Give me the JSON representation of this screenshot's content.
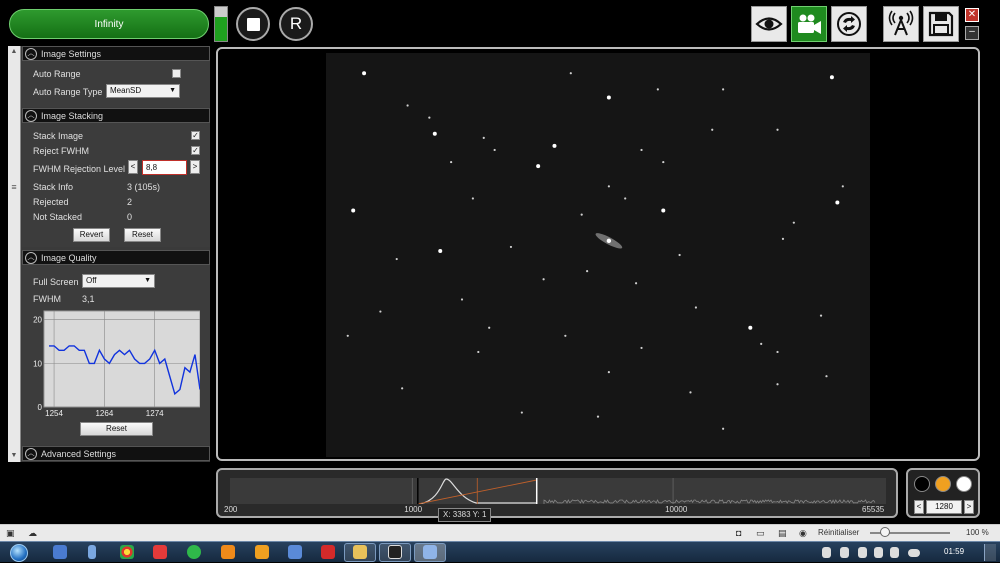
{
  "app": {
    "infinity_label": "Infinity",
    "level_percent": 70,
    "r_label": "R",
    "close_glyph": "✕",
    "minimize_glyph": "–",
    "toolbar_icons": [
      "eye-icon",
      "video-camera-icon",
      "loop-icon",
      "antenna-icon",
      "save-icon"
    ]
  },
  "image_settings": {
    "header": "Image Settings",
    "auto_range_label": "Auto Range",
    "auto_range_checked": false,
    "auto_range_type_label": "Auto Range Type",
    "auto_range_type_value": "MeanSD"
  },
  "image_stacking": {
    "header": "Image Stacking",
    "stack_image_label": "Stack Image",
    "stack_image_checked": true,
    "reject_fwhm_label": "Reject FWHM",
    "reject_fwhm_checked": true,
    "fwhm_rejection_label": "FWHM Rejection Level",
    "fwhm_rejection_value": "8,8",
    "stack_info_label": "Stack Info",
    "stack_info_value": "3 (105s)",
    "rejected_label": "Rejected",
    "rejected_value": "2",
    "not_stacked_label": "Not Stacked",
    "not_stacked_value": "0",
    "revert_label": "Revert",
    "reset_label": "Reset"
  },
  "image_quality": {
    "header": "Image Quality",
    "full_screen_label": "Full Screen",
    "full_screen_value": "Off",
    "fwhm_label": "FWHM",
    "fwhm_value": "3,1",
    "reset_label": "Reset"
  },
  "advanced_settings": {
    "header": "Advanced Settings"
  },
  "chart_data": {
    "type": "line",
    "title": "",
    "xlabel": "",
    "ylabel": "",
    "xlim": [
      1252,
      1283
    ],
    "ylim": [
      0,
      22
    ],
    "x_ticks": [
      "1254",
      "1264",
      "1274"
    ],
    "y_ticks": [
      "0",
      "10",
      "20"
    ],
    "grid": true,
    "x": [
      1253,
      1254,
      1255,
      1256,
      1257,
      1258,
      1259,
      1260,
      1261,
      1262,
      1263,
      1264,
      1265,
      1266,
      1267,
      1268,
      1269,
      1270,
      1271,
      1272,
      1273,
      1274,
      1275,
      1276,
      1277,
      1278,
      1279,
      1280,
      1281,
      1282,
      1283
    ],
    "y": [
      14,
      14,
      13,
      13,
      14,
      14,
      13,
      13,
      10,
      10,
      13,
      11,
      10,
      12,
      13,
      12,
      13,
      11,
      10,
      10,
      11,
      13,
      10,
      11,
      7,
      3,
      4,
      9,
      8,
      12,
      4
    ]
  },
  "histogram": {
    "ticks": [
      "200",
      "1000",
      "10000",
      "65535"
    ],
    "tick_values": [
      200,
      1000,
      10000,
      65535
    ],
    "black_point": 1050,
    "white_point": 3000
  },
  "color_panel": {
    "colors": [
      "#000000",
      "#f0a020",
      "#ffffff"
    ],
    "value": "1280",
    "dec_label": "<",
    "inc_label": ">"
  },
  "coords_label": "X: 3383 Y: 1",
  "status_bar": {
    "reset_label": "Réinitialiser",
    "zoom_label": "100 %"
  },
  "taskbar": {
    "clock": "01:59"
  },
  "stars": [
    [
      0.07,
      0.05,
      1
    ],
    [
      0.93,
      0.06,
      1
    ],
    [
      0.45,
      0.05,
      0
    ],
    [
      0.61,
      0.09,
      0
    ],
    [
      0.2,
      0.2,
      1
    ],
    [
      0.73,
      0.09,
      0
    ],
    [
      0.52,
      0.11,
      1
    ],
    [
      0.15,
      0.13,
      0
    ],
    [
      0.42,
      0.23,
      1
    ],
    [
      0.39,
      0.28,
      1
    ],
    [
      0.29,
      0.21,
      0
    ],
    [
      0.58,
      0.24,
      0
    ],
    [
      0.83,
      0.19,
      0
    ],
    [
      0.62,
      0.27,
      0
    ],
    [
      0.71,
      0.19,
      0
    ],
    [
      0.05,
      0.39,
      1
    ],
    [
      0.23,
      0.27,
      0
    ],
    [
      0.31,
      0.24,
      0
    ],
    [
      0.62,
      0.39,
      1
    ],
    [
      0.86,
      0.42,
      0
    ],
    [
      0.94,
      0.37,
      1
    ],
    [
      0.84,
      0.46,
      0
    ],
    [
      0.21,
      0.49,
      1
    ],
    [
      0.13,
      0.51,
      0
    ],
    [
      0.34,
      0.48,
      0
    ],
    [
      0.48,
      0.54,
      0
    ],
    [
      0.57,
      0.57,
      0
    ],
    [
      0.25,
      0.61,
      0
    ],
    [
      0.68,
      0.63,
      0
    ],
    [
      0.1,
      0.64,
      0
    ],
    [
      0.91,
      0.65,
      0
    ],
    [
      0.78,
      0.68,
      1
    ],
    [
      0.04,
      0.7,
      0
    ],
    [
      0.44,
      0.7,
      0
    ],
    [
      0.58,
      0.73,
      0
    ],
    [
      0.8,
      0.72,
      0
    ],
    [
      0.83,
      0.74,
      0
    ],
    [
      0.28,
      0.74,
      0
    ],
    [
      0.14,
      0.83,
      0
    ],
    [
      0.52,
      0.79,
      0
    ],
    [
      0.67,
      0.84,
      0
    ],
    [
      0.36,
      0.89,
      0
    ],
    [
      0.5,
      0.9,
      0
    ],
    [
      0.73,
      0.93,
      0
    ],
    [
      0.92,
      0.8,
      0
    ],
    [
      0.65,
      0.5,
      0
    ],
    [
      0.47,
      0.4,
      0
    ],
    [
      0.27,
      0.36,
      0
    ],
    [
      0.95,
      0.33,
      0
    ],
    [
      0.52,
      0.33,
      0
    ],
    [
      0.55,
      0.36,
      0
    ],
    [
      0.19,
      0.16,
      0
    ],
    [
      0.83,
      0.82,
      0
    ],
    [
      0.4,
      0.56,
      0
    ],
    [
      0.3,
      0.68,
      0
    ]
  ]
}
